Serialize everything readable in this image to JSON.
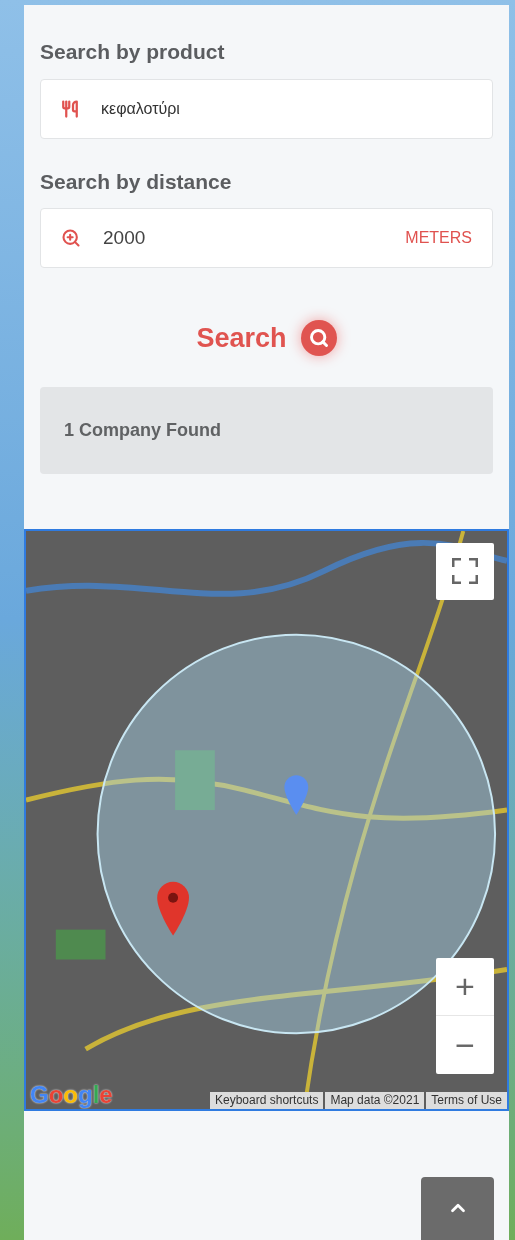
{
  "product_search": {
    "label": "Search by product",
    "value": "κεφαλοτύρι"
  },
  "distance_search": {
    "label": "Search by distance",
    "value": "2000",
    "unit": "METERS"
  },
  "search_button": {
    "label": "Search"
  },
  "results": {
    "text": "1 Company Found"
  },
  "map": {
    "logo": "Google",
    "zoom_in": "+",
    "zoom_out": "−",
    "attribution": [
      "Keyboard shortcuts",
      "Map data ©2021",
      "Terms of Use"
    ]
  }
}
